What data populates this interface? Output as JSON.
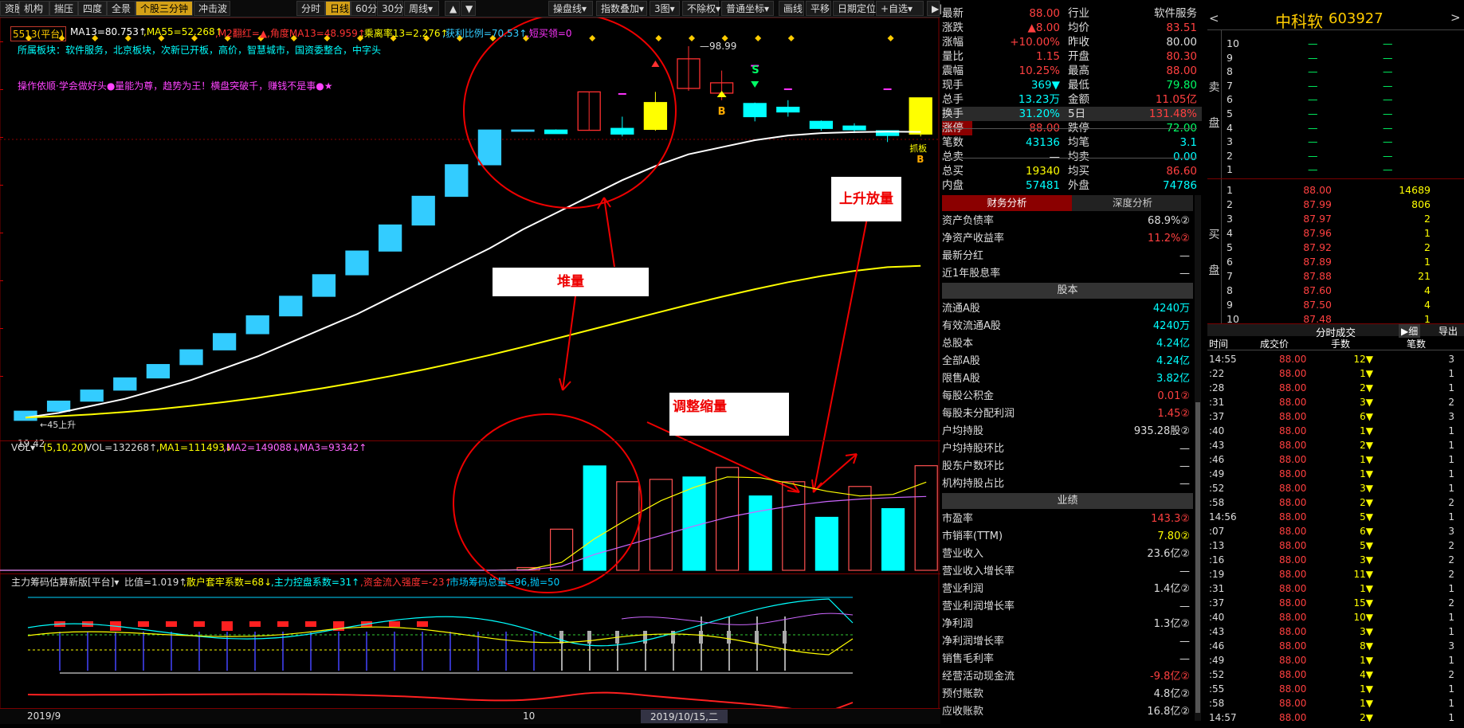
{
  "toolbar": {
    "items": [
      "资股",
      "机构",
      "揣压",
      "四度",
      "全景",
      "个股三分钟",
      "冲击波",
      "分时",
      "日线",
      "60分",
      "30分",
      "周线▾",
      "▲",
      "▼",
      "操盘线▾",
      "指数叠加▾",
      "3图▾",
      "不除权▾",
      "普通坐标▾",
      "画线",
      "平移",
      "日期定位",
      "+自选▾",
      "▶|"
    ]
  },
  "main_indicator": {
    "period_box": "5513(平台)",
    "items": [
      "MA13=80.753↑",
      ",MA55=52.268↑",
      ",M2翻红=▲,角度MA13=48.959↑",
      ",乘离率13=2.276↑",
      ",获利比例=70.53↑",
      ",短买领=0"
    ],
    "tags": "所属板块：软件服务，北京板块，次新已开板，高价，智慧城市，国资委整合，中字头",
    "motto": "操作依顺·学会做好头●量能为尊，趋势为王！横盘突破千，赚钱不是事●★",
    "low_label": "19.42",
    "high_label": "98.99",
    "ma_label": "45上升"
  },
  "annotations": {
    "duiliang": "堆量",
    "shangsheng": "上升放量",
    "tiaozheng": "调整缩量",
    "s_mark": "S",
    "b_mark1": "B",
    "b_mark2": "B",
    "buy_tag": "抓板"
  },
  "vol_indicator": {
    "name": "VOL▾",
    "params": "(5,10,20)",
    "items": [
      "VOL=132268↑",
      ",MA1=111493↓",
      ",MA2=149088↓",
      ",MA3=93342↑"
    ]
  },
  "chip_indicator": {
    "name": "主力筹码估算新版[平台]▾",
    "items": [
      "比值=1.019↑",
      ",散户套牢系数=68↓",
      ",主力控盘系数=31↑",
      ",资金流入强度=-23↑",
      ",市场筹码总量=96,抛=50"
    ]
  },
  "date_axis": {
    "labels": [
      "2019/9",
      "10"
    ],
    "cursor": "2019/10/15,二"
  },
  "chart_data": {
    "type": "candlestick",
    "candles": [
      {
        "o": 19.42,
        "c": 21.36,
        "h": 21.36,
        "l": 19.42
      },
      {
        "o": 21.36,
        "c": 23.5,
        "h": 23.5,
        "l": 23.5
      },
      {
        "o": 23.5,
        "c": 25.85,
        "h": 25.85,
        "l": 25.85
      },
      {
        "o": 25.85,
        "c": 28.44,
        "h": 28.44,
        "l": 28.44
      },
      {
        "o": 28.44,
        "c": 31.28,
        "h": 31.28,
        "l": 31.28
      },
      {
        "o": 31.28,
        "c": 34.41,
        "h": 34.41,
        "l": 34.41
      },
      {
        "o": 34.41,
        "c": 37.85,
        "h": 37.85,
        "l": 37.85
      },
      {
        "o": 37.85,
        "c": 41.64,
        "h": 41.64,
        "l": 41.64
      },
      {
        "o": 41.64,
        "c": 45.8,
        "h": 45.8,
        "l": 45.8
      },
      {
        "o": 45.8,
        "c": 50.38,
        "h": 50.38,
        "l": 50.38
      },
      {
        "o": 50.38,
        "c": 55.42,
        "h": 55.42,
        "l": 55.42
      },
      {
        "o": 55.42,
        "c": 60.96,
        "h": 60.96,
        "l": 60.96
      },
      {
        "o": 60.96,
        "c": 67.06,
        "h": 67.06,
        "l": 67.06
      },
      {
        "o": 67.06,
        "c": 73.77,
        "h": 73.77,
        "l": 73.77
      },
      {
        "o": 73.77,
        "c": 81.15,
        "h": 81.15,
        "l": 81.15
      },
      {
        "o": 81.15,
        "c": 81.15,
        "h": 81.15,
        "l": 81.15
      },
      {
        "o": 81.15,
        "c": 80.4,
        "h": 81.3,
        "l": 80.4
      },
      {
        "o": 81.1,
        "c": 89.27,
        "h": 89.27,
        "l": 81.1
      },
      {
        "o": 81.5,
        "c": 80.3,
        "h": 84.0,
        "l": 79.8
      },
      {
        "o": 81.3,
        "c": 87.0,
        "h": 89.27,
        "l": 81.0
      },
      {
        "o": 90.0,
        "c": 96.3,
        "h": 98.99,
        "l": 89.5
      },
      {
        "o": 89.0,
        "c": 91.2,
        "h": 93.8,
        "l": 87.5
      },
      {
        "o": 86.8,
        "c": 84.0,
        "h": 87.0,
        "l": 83.0
      },
      {
        "o": 86.0,
        "c": 85.0,
        "h": 87.5,
        "l": 84.0
      },
      {
        "o": 83.0,
        "c": 81.5,
        "h": 83.2,
        "l": 81.0
      },
      {
        "o": 82.0,
        "c": 81.2,
        "h": 82.6,
        "l": 80.5
      },
      {
        "o": 81.0,
        "c": 80.0,
        "h": 81.0,
        "l": 78.6
      },
      {
        "o": 80.3,
        "c": 88.0,
        "h": 88.0,
        "l": 79.8
      }
    ],
    "ma13": [
      20,
      21,
      22.5,
      24,
      26,
      28,
      30.5,
      33,
      36,
      39,
      42,
      45.5,
      49,
      52.5,
      56,
      60,
      63.5,
      67,
      70.5,
      73.5,
      76,
      77.5,
      79,
      80,
      80.5,
      80.7,
      80.8,
      80.75
    ],
    "ma55": [
      20,
      20.3,
      20.7,
      21.2,
      21.8,
      22.5,
      23.3,
      24.2,
      25.2,
      26.3,
      27.5,
      28.8,
      30.2,
      31.7,
      33.3,
      35,
      36.8,
      38.6,
      40.4,
      42.2,
      44,
      45.7,
      47.3,
      48.8,
      50.1,
      51.2,
      52.0,
      52.27
    ],
    "volumes": [
      0,
      0,
      0,
      0,
      0,
      0,
      0,
      0,
      0,
      0,
      0,
      0,
      0,
      0,
      0,
      0,
      0,
      3500,
      52000,
      132000,
      112000,
      115000,
      118000,
      130000,
      94000,
      112000,
      67000,
      106000,
      78000,
      132268
    ],
    "vol_up": [
      false,
      false,
      false,
      false,
      false,
      false,
      false,
      false,
      false,
      false,
      false,
      false,
      false,
      false,
      false,
      false,
      false,
      false,
      false,
      true,
      false,
      false,
      true,
      false,
      true,
      false,
      true,
      false,
      true,
      false
    ],
    "vol_ma1": [
      0,
      0,
      0,
      0,
      0,
      0,
      0,
      0,
      0,
      0,
      0,
      0,
      0,
      0,
      0,
      0,
      0,
      1000,
      10000,
      40000,
      65000,
      88000,
      105000,
      118000,
      117000,
      109000,
      100000,
      94000,
      96000,
      111493
    ],
    "vol_ma2": [
      0,
      0,
      0,
      0,
      0,
      0,
      0,
      0,
      0,
      0,
      0,
      0,
      0,
      0,
      0,
      0,
      0,
      500,
      5000,
      20000,
      32000,
      44000,
      56000,
      67000,
      75000,
      82000,
      87000,
      90000,
      92000,
      93342
    ],
    "ylim_price": [
      17,
      100
    ],
    "ylim_vol": [
      0,
      140000
    ]
  },
  "quote": {
    "left": [
      [
        "最新",
        "88.00"
      ],
      [
        "涨跌",
        "▲8.00"
      ],
      [
        "涨幅",
        "+10.00%"
      ],
      [
        "量比",
        "1.15"
      ],
      [
        "震幅",
        "10.25%"
      ],
      [
        "现手",
        "369▼"
      ],
      [
        "总手",
        "13.23万"
      ],
      [
        "换手",
        "31.20%"
      ],
      [
        "涨停",
        "88.00"
      ],
      [
        "笔数",
        "43136"
      ],
      [
        "总卖",
        "—"
      ],
      [
        "总买",
        "19340"
      ],
      [
        "内盘",
        "57481"
      ]
    ],
    "right": [
      [
        "行业",
        "软件服务"
      ],
      [
        "均价",
        "83.51"
      ],
      [
        "昨收",
        "80.00"
      ],
      [
        "开盘",
        "80.30"
      ],
      [
        "最高",
        "88.00"
      ],
      [
        "最低",
        "79.80"
      ],
      [
        "金额",
        "11.05亿"
      ],
      [
        "5日",
        "131.48%"
      ],
      [
        "跌停",
        "72.00"
      ],
      [
        "均笔",
        "3.1"
      ],
      [
        "均卖",
        "0.00"
      ],
      [
        "均买",
        "86.60"
      ],
      [
        "外盘",
        "74786"
      ]
    ]
  },
  "finance": {
    "tabs": [
      "财务分析",
      "深度分析"
    ],
    "rows1": [
      [
        "资产负债率",
        "68.9%②"
      ],
      [
        "净资产收益率",
        "11.2%②"
      ],
      [
        "最新分红",
        "—"
      ],
      [
        "近1年股息率",
        "—"
      ]
    ],
    "section1": "股本",
    "rows2": [
      [
        "流通A股",
        "4240万"
      ],
      [
        "有效流通A股",
        "4240万"
      ],
      [
        "总股本",
        "4.24亿"
      ],
      [
        "全部A股",
        "4.24亿"
      ],
      [
        "限售A股",
        "3.82亿"
      ],
      [
        "每股公积金",
        "0.01②"
      ],
      [
        "每股未分配利润",
        "1.45②"
      ],
      [
        "户均持股",
        "935.28股②"
      ],
      [
        "户均持股环比",
        "—"
      ],
      [
        "股东户数环比",
        "—"
      ],
      [
        "机构持股占比",
        "—"
      ]
    ],
    "section2": "业绩",
    "rows3": [
      [
        "市盈率",
        "143.3②"
      ],
      [
        "市销率(TTM)",
        "7.80②"
      ],
      [
        "营业收入",
        "23.6亿②"
      ],
      [
        "营业收入增长率",
        "—"
      ],
      [
        "营业利润",
        "1.4亿②"
      ],
      [
        "营业利润增长率",
        "—"
      ],
      [
        "净利润",
        "1.3亿②"
      ],
      [
        "净利润增长率",
        "—"
      ],
      [
        "销售毛利率",
        "—"
      ],
      [
        "经营活动现金流",
        "-9.8亿②"
      ],
      [
        "预付账款",
        "4.8亿②"
      ],
      [
        "应收账款",
        "16.8亿②"
      ]
    ]
  },
  "orderbook": {
    "name": "中科软",
    "code": "603927",
    "sell_label": "卖盘",
    "buy_label": "买盘",
    "sells": [
      [
        "10",
        "—",
        "—"
      ],
      [
        "9",
        "—",
        "—"
      ],
      [
        "8",
        "—",
        "—"
      ],
      [
        "7",
        "—",
        "—"
      ],
      [
        "6",
        "—",
        "—"
      ],
      [
        "5",
        "—",
        "—"
      ],
      [
        "4",
        "—",
        "—"
      ],
      [
        "3",
        "—",
        "—"
      ],
      [
        "2",
        "—",
        "—"
      ],
      [
        "1",
        "—",
        "—"
      ]
    ],
    "buys": [
      [
        "1",
        "88.00",
        "14689"
      ],
      [
        "2",
        "87.99",
        "806"
      ],
      [
        "3",
        "87.97",
        "2"
      ],
      [
        "4",
        "87.96",
        "1"
      ],
      [
        "5",
        "87.92",
        "2"
      ],
      [
        "6",
        "87.89",
        "1"
      ],
      [
        "7",
        "87.88",
        "21"
      ],
      [
        "8",
        "87.60",
        "4"
      ],
      [
        "9",
        "87.50",
        "4"
      ],
      [
        "10",
        "87.48",
        "1"
      ]
    ],
    "ticks_title": "分时成交",
    "ticks_btn1": "▶细",
    "ticks_btn2": "导出",
    "ticks_headers": [
      "时间",
      "成交价",
      "手数",
      "笔数"
    ],
    "ticks": [
      [
        "14:55",
        "88.00",
        "12▼",
        "3"
      ],
      [
        ":22",
        "88.00",
        "1▼",
        "1"
      ],
      [
        ":28",
        "88.00",
        "2▼",
        "1"
      ],
      [
        ":31",
        "88.00",
        "3▼",
        "2"
      ],
      [
        ":37",
        "88.00",
        "6▼",
        "3"
      ],
      [
        ":40",
        "88.00",
        "1▼",
        "1"
      ],
      [
        ":43",
        "88.00",
        "2▼",
        "1"
      ],
      [
        ":46",
        "88.00",
        "1▼",
        "1"
      ],
      [
        ":49",
        "88.00",
        "1▼",
        "1"
      ],
      [
        ":52",
        "88.00",
        "3▼",
        "1"
      ],
      [
        ":58",
        "88.00",
        "2▼",
        "2"
      ],
      [
        "14:56",
        "88.00",
        "5▼",
        "1"
      ],
      [
        ":07",
        "88.00",
        "6▼",
        "3"
      ],
      [
        ":13",
        "88.00",
        "5▼",
        "2"
      ],
      [
        ":16",
        "88.00",
        "3▼",
        "2"
      ],
      [
        ":19",
        "88.00",
        "11▼",
        "2"
      ],
      [
        ":31",
        "88.00",
        "1▼",
        "1"
      ],
      [
        ":37",
        "88.00",
        "15▼",
        "2"
      ],
      [
        ":40",
        "88.00",
        "10▼",
        "1"
      ],
      [
        ":43",
        "88.00",
        "3▼",
        "1"
      ],
      [
        ":46",
        "88.00",
        "8▼",
        "3"
      ],
      [
        ":49",
        "88.00",
        "1▼",
        "1"
      ],
      [
        ":52",
        "88.00",
        "4▼",
        "2"
      ],
      [
        ":55",
        "88.00",
        "1▼",
        "1"
      ],
      [
        ":58",
        "88.00",
        "1▼",
        "1"
      ],
      [
        "14:57",
        "88.00",
        "2▼",
        "1"
      ]
    ]
  }
}
